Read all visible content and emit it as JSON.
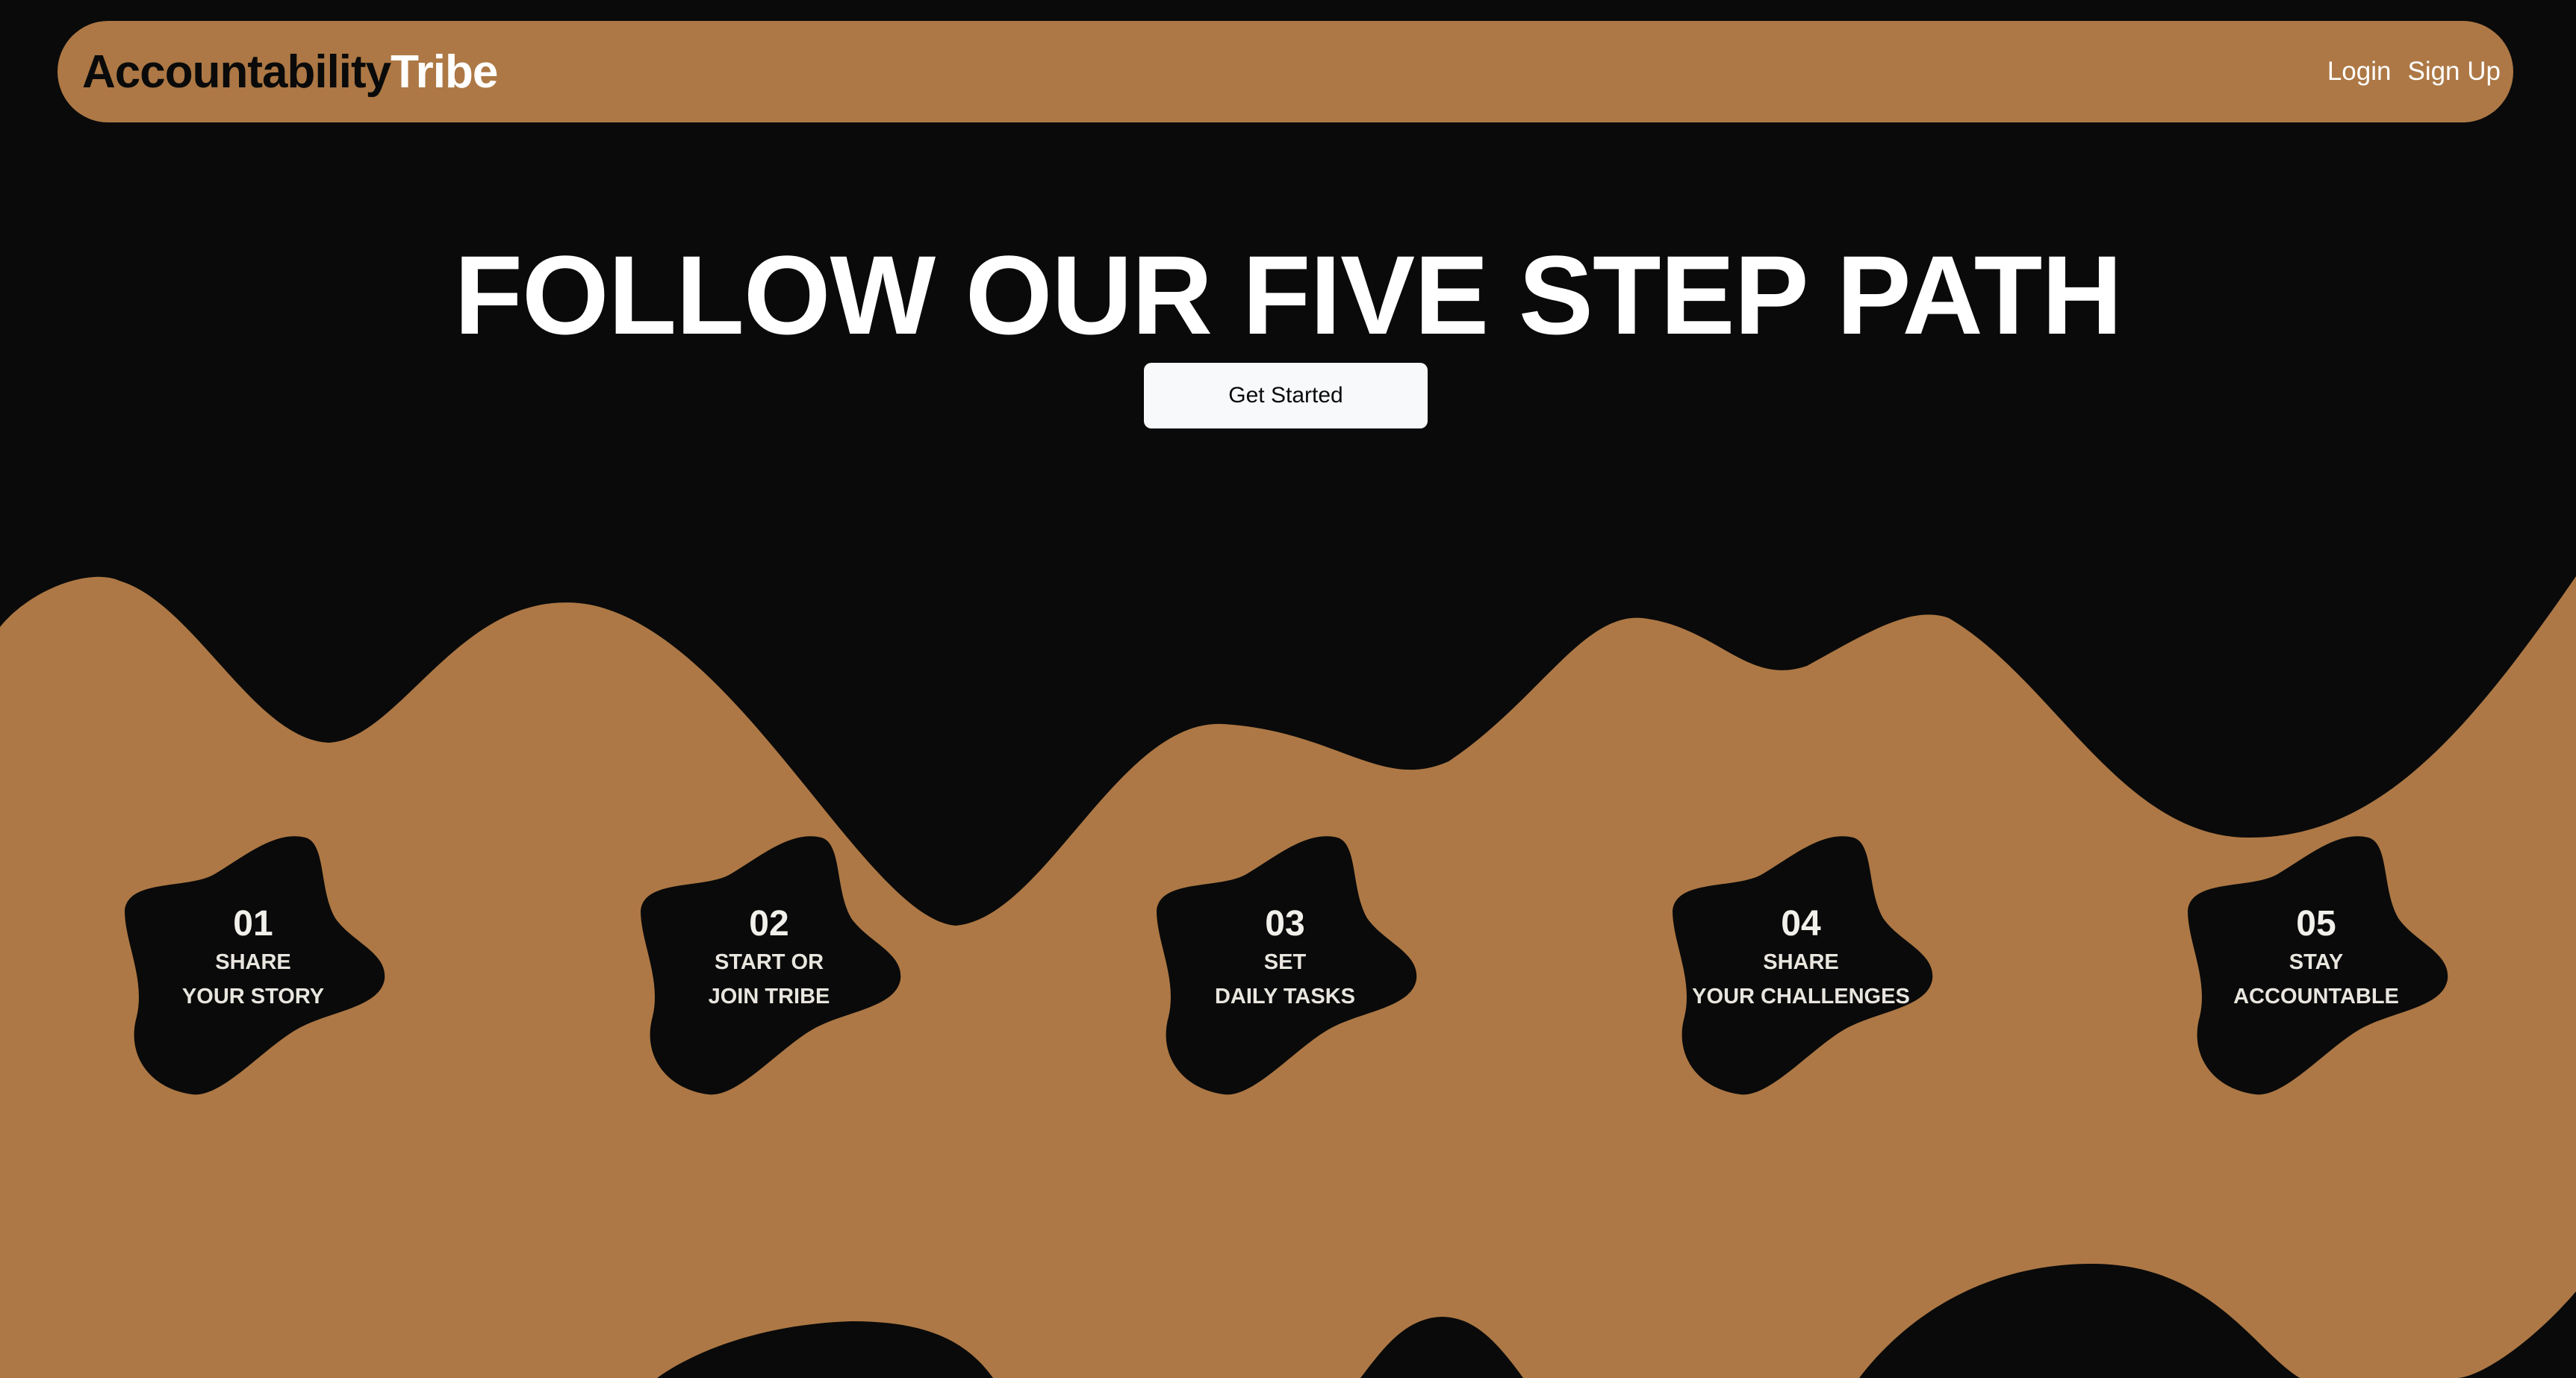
{
  "header": {
    "brand_first": "Accountability",
    "brand_second": "Tribe",
    "nav": {
      "login": "Login",
      "signup": "Sign Up"
    }
  },
  "hero": {
    "title": "FOLLOW OUR FIVE STEP PATH",
    "cta_label": "Get Started"
  },
  "steps": [
    {
      "number": "01",
      "line1": "SHARE",
      "line2": "YOUR STORY"
    },
    {
      "number": "02",
      "line1": "START OR",
      "line2": "JOIN TRIBE"
    },
    {
      "number": "03",
      "line1": "SET",
      "line2": "DAILY TASKS"
    },
    {
      "number": "04",
      "line1": "SHARE",
      "line2": "YOUR CHALLENGES"
    },
    {
      "number": "05",
      "line1": "STAY",
      "line2": "ACCOUNTABLE"
    }
  ],
  "colors": {
    "background": "#0a0a0a",
    "accent": "#ad7845",
    "button_bg": "#f7f9fb",
    "text_light": "#ffffff"
  }
}
